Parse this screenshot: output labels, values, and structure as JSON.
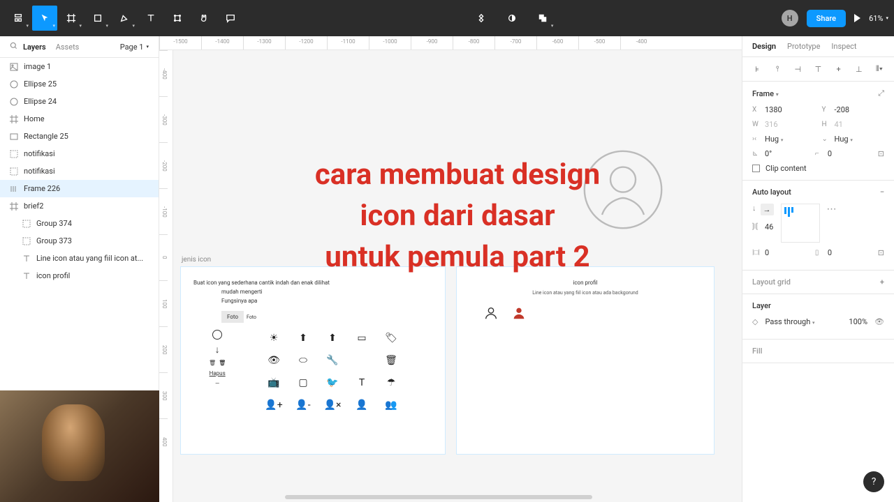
{
  "toolbar": {
    "avatar_letter": "H",
    "share_label": "Share",
    "zoom": "61%"
  },
  "left_panel": {
    "tabs": {
      "layers": "Layers",
      "assets": "Assets"
    },
    "page": "Page 1",
    "layers": [
      {
        "icon": "image",
        "label": "image 1"
      },
      {
        "icon": "ellipse",
        "label": "Ellipse 25"
      },
      {
        "icon": "ellipse",
        "label": "Ellipse 24"
      },
      {
        "icon": "frame",
        "label": "Home"
      },
      {
        "icon": "rect",
        "label": "Rectangle 25"
      },
      {
        "icon": "group",
        "label": "notifikasi"
      },
      {
        "icon": "group",
        "label": "notifikasi"
      },
      {
        "icon": "autolayout",
        "label": "Frame 226",
        "selected": true
      },
      {
        "icon": "frame",
        "label": "brief2"
      },
      {
        "icon": "group",
        "label": "Group 374",
        "child": true
      },
      {
        "icon": "group",
        "label": "Group 373",
        "child": true
      },
      {
        "icon": "text",
        "label": "Line icon atau yang fiil icon at...",
        "child": true
      },
      {
        "icon": "text",
        "label": "icon profil",
        "child": true
      }
    ]
  },
  "ruler_h": [
    "-1500",
    "-1400",
    "-1300",
    "-1200",
    "-1100",
    "-1000",
    "-900",
    "-800",
    "-700",
    "-600",
    "-500",
    "-400"
  ],
  "ruler_v": [
    "-400",
    "-300",
    "-200",
    "-100",
    "0",
    "100",
    "200",
    "300",
    "400"
  ],
  "canvas": {
    "overlay_line1": "cara membuat design",
    "overlay_line2": "icon dari dasar",
    "overlay_line3": "untuk pemula part 2",
    "frame_label": "jenis icon",
    "ab1": {
      "desc": "Buat icon yang sederhana cantik indah dan enak dilihat",
      "line2": "mudah mengerti",
      "line3": "Fungsinya apa",
      "tag": "Foto",
      "tag2": "Foto",
      "hapus": "Hapus"
    },
    "ab2": {
      "title": "icon profil",
      "sub": "Line icon atau yang fiil icon atau ada backgorund"
    }
  },
  "right_panel": {
    "tabs": {
      "design": "Design",
      "prototype": "Prototype",
      "inspect": "Inspect"
    },
    "frame_label": "Frame",
    "x": "1380",
    "y": "-208",
    "w": "316",
    "h": "41",
    "hug": "Hug",
    "rotation": "0°",
    "radius": "0",
    "clip": "Clip content",
    "autolayout": "Auto layout",
    "gap": "46",
    "pad_h": "0",
    "pad_v": "0",
    "layout_grid": "Layout grid",
    "layer": "Layer",
    "blend": "Pass through",
    "opacity": "100%",
    "fill": "Fill"
  },
  "help": "?"
}
